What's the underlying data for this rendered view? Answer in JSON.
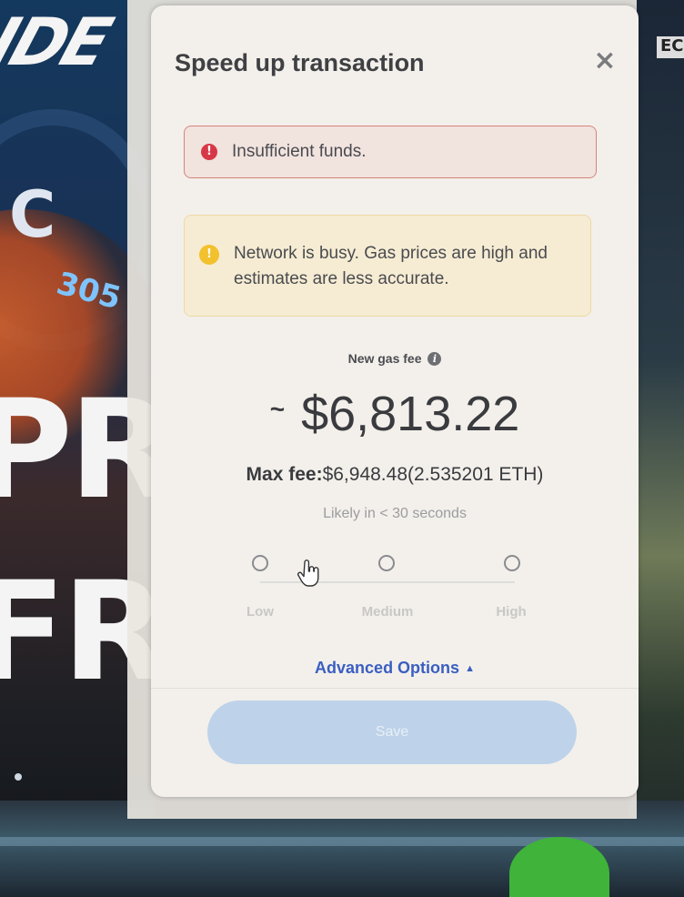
{
  "modal": {
    "title": "Speed up transaction",
    "close_symbol": "×"
  },
  "alerts": {
    "error": {
      "icon": "error-icon",
      "icon_glyph": "!",
      "text": "Insufficient funds.",
      "color": "#d73847"
    },
    "warning": {
      "icon": "warning-icon",
      "icon_glyph": "!",
      "text": "Network is busy. Gas prices are high and estimates are less accurate.",
      "color": "#f2c12e"
    }
  },
  "gas": {
    "label": "New gas fee",
    "info_glyph": "i",
    "approx": "~",
    "amount": "$6,813.22",
    "max_fee_label": "Max fee:",
    "max_fee_value": "$6,948.48",
    "max_fee_eth": "(2.535201 ETH)",
    "likely": "Likely in < 30 seconds"
  },
  "speed": {
    "options": [
      "Low",
      "Medium",
      "High"
    ]
  },
  "advanced": {
    "label": "Advanced Options",
    "caret": "▲"
  },
  "save_button": {
    "label": "Save"
  },
  "background": {
    "logo_text": "IDE",
    "letter_c": "C",
    "number": "305",
    "line1": "PRO",
    "line2": "FRE",
    "corner_text": "EC"
  },
  "colors": {
    "accent": "#3a5ec2",
    "save_disabled": "#bed3ea",
    "modal_bg": "#f3f0eb"
  }
}
